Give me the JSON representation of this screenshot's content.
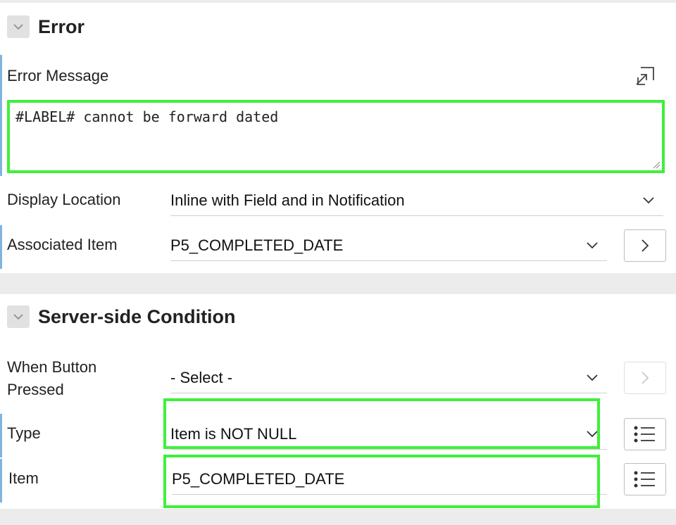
{
  "error_section": {
    "title": "Error",
    "error_message": {
      "label": "Error Message",
      "value": "#LABEL# cannot be forward dated"
    },
    "display_location": {
      "label": "Display Location",
      "value": "Inline with Field and in Notification"
    },
    "associated_item": {
      "label": "Associated Item",
      "value": "P5_COMPLETED_DATE"
    }
  },
  "server_condition_section": {
    "title": "Server-side Condition",
    "when_button_pressed": {
      "label_line1": "When Button",
      "label_line2": "Pressed",
      "value": "- Select -"
    },
    "type": {
      "label": "Type",
      "value": "Item is NOT NULL"
    },
    "item": {
      "label": "Item",
      "value": "P5_COMPLETED_DATE"
    }
  },
  "colors": {
    "highlight": "#3ef03a",
    "row_marker": "#7fb4df",
    "background": "#ececec"
  },
  "icons": {
    "collapse": "chevron-down-icon",
    "expand_editor": "expand-arrow-icon",
    "go": "chevron-right-icon",
    "list": "list-icon"
  }
}
